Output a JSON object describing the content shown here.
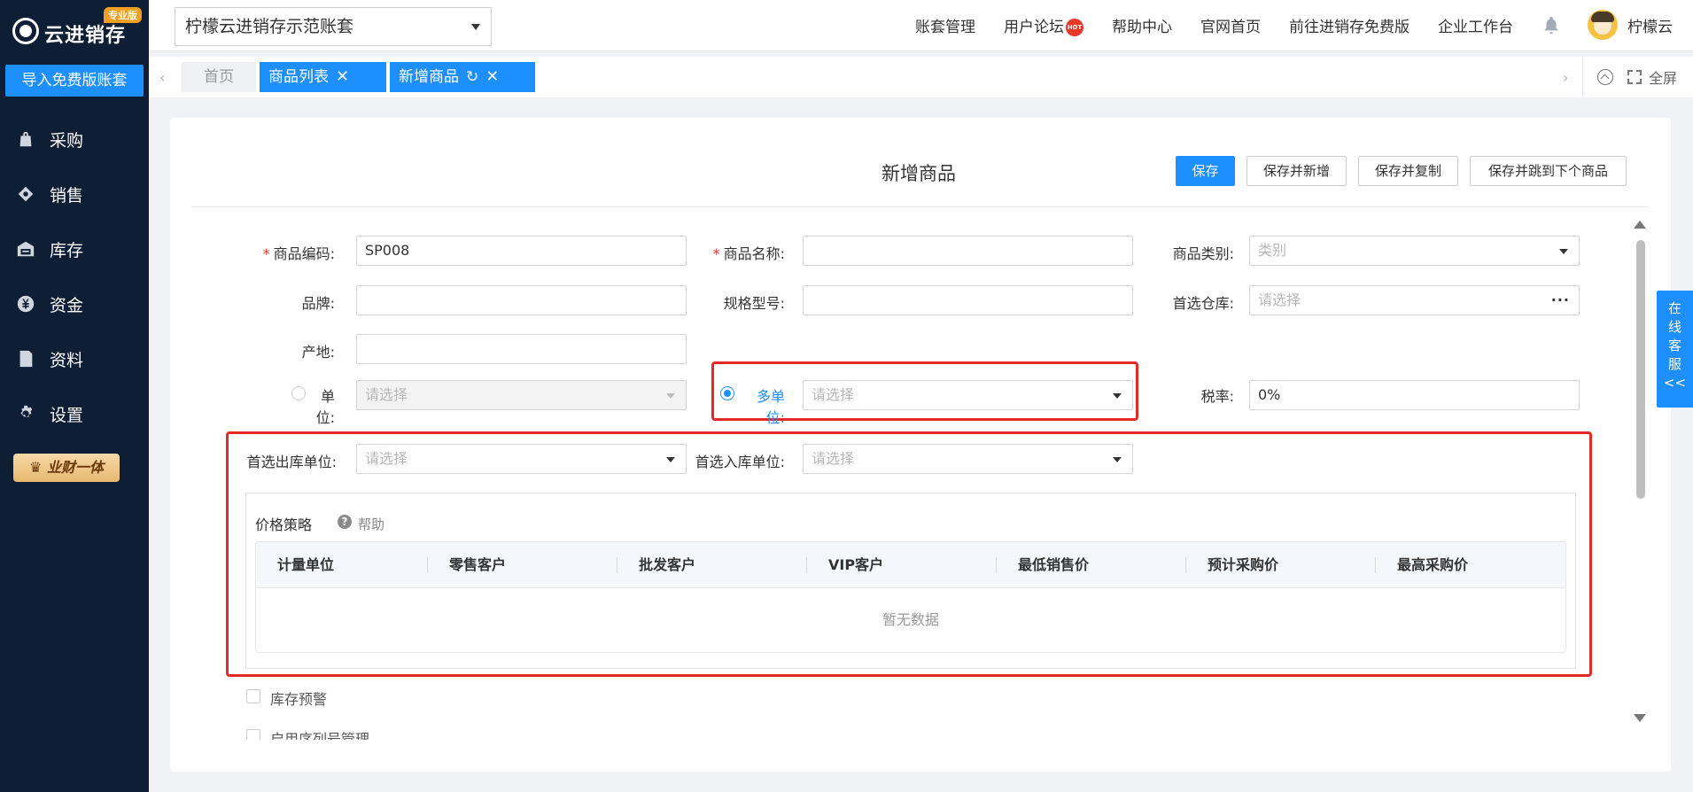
{
  "sidebar": {
    "logo_text": "云进销存",
    "logo_badge": "专业版",
    "import_button": "导入免费版账套",
    "items": [
      {
        "label": "采购",
        "icon": "shopping-bag-icon"
      },
      {
        "label": "销售",
        "icon": "sales-tag-icon"
      },
      {
        "label": "库存",
        "icon": "warehouse-icon"
      },
      {
        "label": "资金",
        "icon": "yen-coin-icon"
      },
      {
        "label": "资料",
        "icon": "document-icon"
      },
      {
        "label": "设置",
        "icon": "gear-icon"
      }
    ],
    "promo": "业财一体"
  },
  "header": {
    "account": "柠檬云进销存示范账套",
    "links": [
      "账套管理",
      "用户论坛",
      "帮助中心",
      "官网首页",
      "前往进销存免费版",
      "企业工作台"
    ],
    "hot_badge": "HOT",
    "username": "柠檬云"
  },
  "tabs": {
    "home": "首页",
    "items": [
      {
        "label": "商品列表"
      },
      {
        "label": "新增商品"
      }
    ],
    "fullscreen": "全屏"
  },
  "form": {
    "title": "新增商品",
    "buttons": {
      "save": "保存",
      "save_new": "保存并新增",
      "save_copy": "保存并复制",
      "save_next": "保存并跳到下个商品"
    },
    "labels": {
      "code": "商品编码:",
      "name": "商品名称:",
      "category": "商品类别:",
      "brand": "品牌:",
      "spec": "规格型号:",
      "warehouse": "首选仓库:",
      "origin": "产地:",
      "unit": "单位:",
      "multi_unit": "多单位:",
      "tax": "税率:",
      "out_unit": "首选出库单位:",
      "in_unit": "首选入库单位:"
    },
    "values": {
      "code": "SP008",
      "name": "",
      "brand": "",
      "spec": "",
      "origin": "",
      "tax": "0%"
    },
    "placeholders": {
      "category": "类别",
      "warehouse": "请选择",
      "unit": "请选择",
      "multi_unit": "请选择",
      "out_unit": "请选择",
      "in_unit": "请选择"
    },
    "unit_mode": "multi"
  },
  "price_strategy": {
    "title": "价格策略",
    "help": "帮助",
    "columns": [
      "计量单位",
      "零售客户",
      "批发客户",
      "VIP客户",
      "最低销售价",
      "预计采购价",
      "最高采购价"
    ],
    "empty_text": "暂无数据"
  },
  "options": {
    "stock_warning": "库存预警",
    "serial_mgmt": "启用序列号管理"
  },
  "service": {
    "chars": [
      "在",
      "线",
      "客",
      "服"
    ],
    "arrow": "<<"
  },
  "colors": {
    "sidebar_bg": "#0e1e34",
    "primary": "#1e8fff",
    "highlight_box": "#e52929"
  }
}
